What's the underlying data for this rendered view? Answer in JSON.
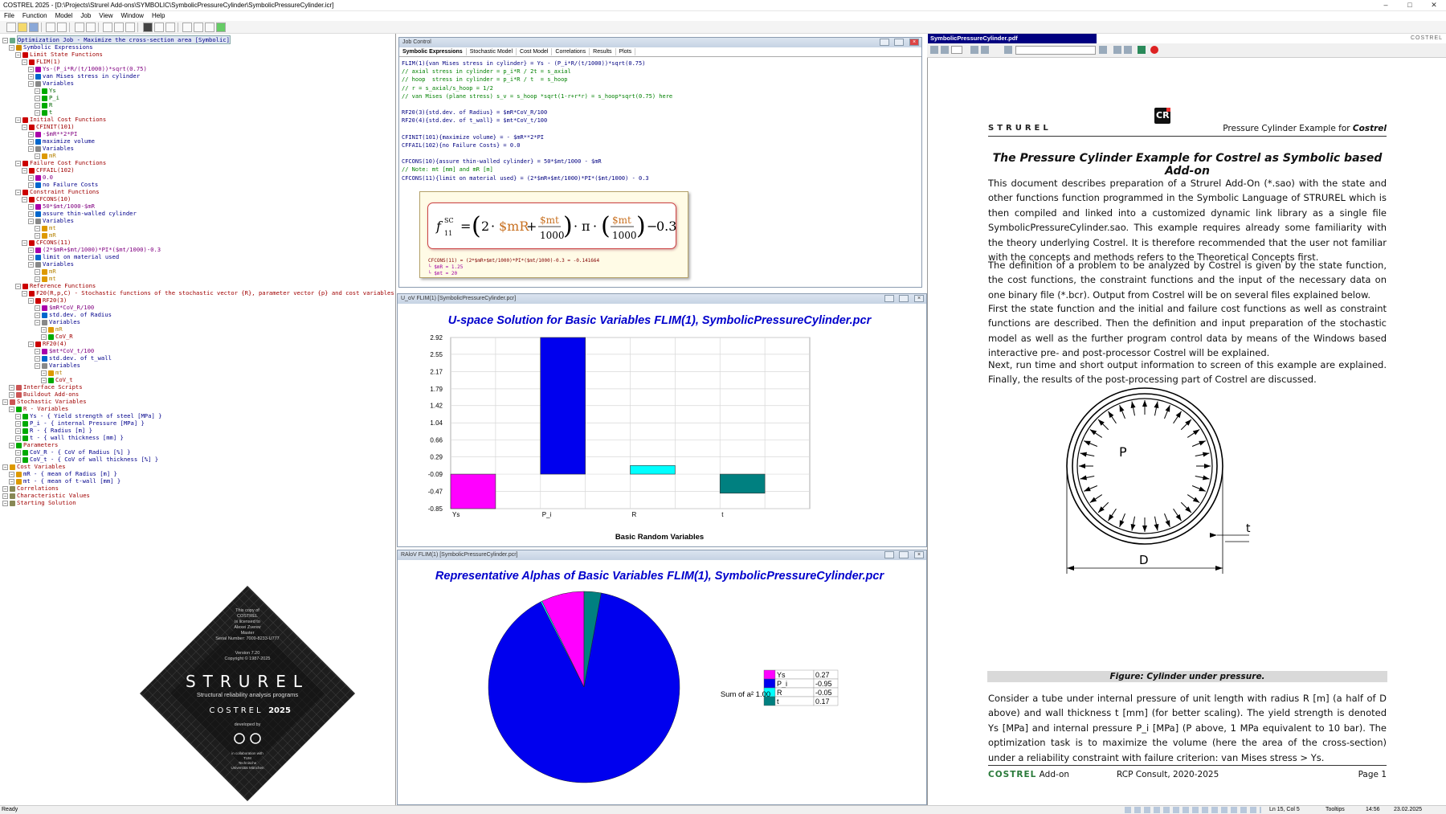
{
  "window": {
    "title": "COSTREL 2025 - [D:\\Projects\\Strurel Add-ons\\SYMBOLIC\\SymbolicPressureCylinder\\SymbolicPressureCylinder.icr]",
    "min": "–",
    "max": "□",
    "close": "✕"
  },
  "menu": [
    "File",
    "Function",
    "Model",
    "Job",
    "View",
    "Window",
    "Help"
  ],
  "tree": [
    {
      "d": 0,
      "t": "Optimization Job - Maximize the cross-section area [Symbolic]",
      "c": "c-blue",
      "hl": true,
      "ic": "#6a8"
    },
    {
      "d": 1,
      "t": "Symbolic Expressions",
      "c": "c-blue",
      "ic": "#c80"
    },
    {
      "d": 2,
      "t": "Limit State Functions",
      "c": "c-red",
      "ic": "#c00"
    },
    {
      "d": 3,
      "t": "FLIM(1)",
      "c": "c-red",
      "ic": "#c00"
    },
    {
      "d": 4,
      "t": "Ys-(P_i*R/(t/1000))*sqrt(0.75)",
      "c": "c-mag",
      "ic": "#a0a"
    },
    {
      "d": 4,
      "t": "van Mises stress in cylinder",
      "c": "c-blue",
      "ic": "#06c"
    },
    {
      "d": 4,
      "t": "Variables",
      "c": "c-blue",
      "ic": "#888"
    },
    {
      "d": 5,
      "t": "Ys",
      "c": "c-grn",
      "ic": "#0a0"
    },
    {
      "d": 5,
      "t": "P_i",
      "c": "c-grn",
      "ic": "#0a0"
    },
    {
      "d": 5,
      "t": "R",
      "c": "c-grn",
      "ic": "#0a0"
    },
    {
      "d": 5,
      "t": "t",
      "c": "c-grn",
      "ic": "#0a0"
    },
    {
      "d": 2,
      "t": "Initial Cost Functions",
      "c": "c-red",
      "ic": "#c00"
    },
    {
      "d": 3,
      "t": "CFINIT(101)",
      "c": "c-red",
      "ic": "#c00"
    },
    {
      "d": 4,
      "t": "-$mR**2*PI",
      "c": "c-mag",
      "ic": "#a0a"
    },
    {
      "d": 4,
      "t": "maximize volume",
      "c": "c-blue",
      "ic": "#06c"
    },
    {
      "d": 4,
      "t": "Variables",
      "c": "c-blue",
      "ic": "#888"
    },
    {
      "d": 5,
      "t": "mR",
      "c": "c-org",
      "ic": "#d90"
    },
    {
      "d": 2,
      "t": "Failure Cost Functions",
      "c": "c-red",
      "ic": "#c00"
    },
    {
      "d": 3,
      "t": "CFFAIL(102)",
      "c": "c-red",
      "ic": "#c00"
    },
    {
      "d": 4,
      "t": "0.0",
      "c": "c-mag",
      "ic": "#a0a"
    },
    {
      "d": 4,
      "t": "no Failure Costs",
      "c": "c-blue",
      "ic": "#06c"
    },
    {
      "d": 2,
      "t": "Constraint Functions",
      "c": "c-red",
      "ic": "#c00"
    },
    {
      "d": 3,
      "t": "CFCONS(10)",
      "c": "c-red",
      "ic": "#c00"
    },
    {
      "d": 4,
      "t": "50*$mt/1000-$mR",
      "c": "c-mag",
      "ic": "#a0a"
    },
    {
      "d": 4,
      "t": "assure thin-walled cylinder",
      "c": "c-blue",
      "ic": "#06c"
    },
    {
      "d": 4,
      "t": "Variables",
      "c": "c-blue",
      "ic": "#888"
    },
    {
      "d": 5,
      "t": "mt",
      "c": "c-org",
      "ic": "#d90"
    },
    {
      "d": 5,
      "t": "mR",
      "c": "c-org",
      "ic": "#d90"
    },
    {
      "d": 3,
      "t": "CFCONS(11)",
      "c": "c-red",
      "ic": "#c00"
    },
    {
      "d": 4,
      "t": "(2*$mR+$mt/1000)*PI*($mt/1000)-0.3",
      "c": "c-mag",
      "ic": "#a0a"
    },
    {
      "d": 4,
      "t": "limit on material used",
      "c": "c-blue",
      "ic": "#06c"
    },
    {
      "d": 4,
      "t": "Variables",
      "c": "c-blue",
      "ic": "#888"
    },
    {
      "d": 5,
      "t": "mR",
      "c": "c-org",
      "ic": "#d90"
    },
    {
      "d": 5,
      "t": "mt",
      "c": "c-org",
      "ic": "#d90"
    },
    {
      "d": 2,
      "t": "Reference Functions",
      "c": "c-red",
      "ic": "#c00"
    },
    {
      "d": 3,
      "t": "F20(R,p,C) - Stochastic functions of the stochastic vector {R}, parameter vector {p} and cost variables {$}",
      "c": "c-red",
      "ic": "#c00"
    },
    {
      "d": 4,
      "t": "RF20(3)",
      "c": "c-red",
      "ic": "#c00"
    },
    {
      "d": 5,
      "t": "$mR*CoV_R/100",
      "c": "c-mag",
      "ic": "#a0a"
    },
    {
      "d": 5,
      "t": "std.dev. of Radius",
      "c": "c-blue",
      "ic": "#06c"
    },
    {
      "d": 5,
      "t": "Variables",
      "c": "c-blue",
      "ic": "#888"
    },
    {
      "d": 6,
      "t": "mR",
      "c": "c-org",
      "ic": "#d90"
    },
    {
      "d": 6,
      "t": "CoV_R",
      "c": "c-red",
      "ic": "#0a0"
    },
    {
      "d": 4,
      "t": "RF20(4)",
      "c": "c-red",
      "ic": "#c00"
    },
    {
      "d": 5,
      "t": "$mt*CoV_t/100",
      "c": "c-mag",
      "ic": "#a0a"
    },
    {
      "d": 5,
      "t": "std.dev. of t_wall",
      "c": "c-blue",
      "ic": "#06c"
    },
    {
      "d": 5,
      "t": "Variables",
      "c": "c-blue",
      "ic": "#888"
    },
    {
      "d": 6,
      "t": "mt",
      "c": "c-org",
      "ic": "#d90"
    },
    {
      "d": 6,
      "t": "CoV_t",
      "c": "c-red",
      "ic": "#0a0"
    },
    {
      "d": 1,
      "t": "Interface Scripts",
      "c": "c-red",
      "ic": "#c55"
    },
    {
      "d": 1,
      "t": "Buildout Add-ons",
      "c": "c-red",
      "ic": "#c55"
    },
    {
      "d": 0,
      "t": "Stochastic Variables",
      "c": "c-red",
      "ic": "#c55"
    },
    {
      "d": 1,
      "t": "R - Variables",
      "c": "c-red",
      "ic": "#0a0"
    },
    {
      "d": 2,
      "t": "Ys - { Yield strength of steel [MPa] }",
      "c": "c-blue",
      "ic": "#0a0"
    },
    {
      "d": 2,
      "t": "P_i - { internal Pressure [MPa] }",
      "c": "c-blue",
      "ic": "#0a0"
    },
    {
      "d": 2,
      "t": "R - { Radius [m] }",
      "c": "c-blue",
      "ic": "#0a0"
    },
    {
      "d": 2,
      "t": "t - { wall thickness [mm] }",
      "c": "c-blue",
      "ic": "#0a0"
    },
    {
      "d": 1,
      "t": "Parameters",
      "c": "c-red",
      "ic": "#0a0"
    },
    {
      "d": 2,
      "t": "CoV_R - { CoV of Radius [%] }",
      "c": "c-blue",
      "ic": "#0a0"
    },
    {
      "d": 2,
      "t": "CoV_t - { CoV of wall thickness [%] }",
      "c": "c-blue",
      "ic": "#0a0"
    },
    {
      "d": 0,
      "t": "Cost Variables",
      "c": "c-red",
      "ic": "#d90"
    },
    {
      "d": 1,
      "t": "mR - { mean of Radius [m] }",
      "c": "c-blue",
      "ic": "#d90"
    },
    {
      "d": 1,
      "t": "mt - { mean of t-wall [mm] }",
      "c": "c-blue",
      "ic": "#d90"
    },
    {
      "d": 0,
      "t": "Correlations",
      "c": "c-red",
      "ic": "#885"
    },
    {
      "d": 0,
      "t": "Characteristic Values",
      "c": "c-red",
      "ic": "#885"
    },
    {
      "d": 0,
      "t": "Starting Solution",
      "c": "c-red",
      "ic": "#885"
    }
  ],
  "badge": {
    "copy": [
      "This copy of",
      "COSTREL",
      "is licensed to",
      "Alexei Zverev",
      "Master",
      "Serial Number: 7009-8233-U777"
    ],
    "version": "Version 7.20",
    "copyright": "Copyright © 1987-2025",
    "brand": "STRUREL",
    "sub": "Structural reliability analysis programs",
    "costrel": "COSTREL",
    "year": "2025",
    "developed": "developed by",
    "collab": [
      "in collaboration with",
      "TUM",
      "Technische",
      "Universität München"
    ]
  },
  "job": {
    "title": "Job Control",
    "tabs": [
      "Symbolic Expressions",
      "Stochastic Model",
      "Cost Model",
      "Correlations",
      "Results",
      "Plots"
    ],
    "code": [
      "FLIM(1){van Mises stress in cylinder} = Ys - (P_i*R/(t/1000))*sqrt(0.75)",
      "// axial stress in cylinder = p_i*R / 2t = s_axial",
      "// hoop  stress in cylinder = p_i*R / t  = s_hoop",
      "// r = s_axial/s_hoop = 1/2",
      "// van Mises (plane stress) s_v = s_hoop *sqrt(1-r+r*r) = s_hoop*sqrt(0.75) here",
      "",
      "RF20(3){std.dev. of Radius} = $mR*CoV_R/100",
      "RF20(4){std.dev. of t_wall} = $mt*CoV_t/100",
      "",
      "CFINIT(101){maximize volume} = - $mR**2*PI",
      "CFFAIL(102){no Failure Costs} = 0.0",
      "",
      "CFCONS(10){assure thin-walled cylinder} = 50*$mt/1000 - $mR",
      "// Note: mt [mm] and mR [m]",
      "CFCONS(11){limit on material used} = (2*$mR+$mt/1000)*PI*($mt/1000) - 0.3"
    ],
    "tip": {
      "formula_lhs": "f",
      "formula_sup": "SC",
      "formula_sub": "11",
      "result": "CFCONS(11) = (2*$mR+$mt/1000)*PI*($mt/1000)-0.3 = -0.141664",
      "v1": "└ $mR = 1.25",
      "v2": "└ $mt = 20"
    }
  },
  "chart_win_title": "U_oV FLIM(1) [SymbolicPressureCylinder.pcr]",
  "pie_win_title": "RAloV FLIM(1) [SymbolicPressureCylinder.pcr]",
  "chart_data": [
    {
      "type": "bar",
      "title": "U-space Solution for Basic Variables FLIM(1), SymbolicPressureCylinder.pcr",
      "xlabel": "Basic Random Variables",
      "ylabel": "",
      "categories": [
        "Ys",
        "P_i",
        "R",
        "t"
      ],
      "values": [
        -0.85,
        2.92,
        0.1,
        -0.51
      ],
      "colors": [
        "#ff00ff",
        "#0000ee",
        "#00ffff",
        "#008080"
      ],
      "yticks": [
        2.92,
        2.55,
        2.17,
        1.79,
        1.42,
        1.04,
        0.66,
        0.29,
        -0.09,
        -0.47,
        -0.85
      ],
      "ylim": [
        -0.85,
        2.92
      ],
      "grid": true
    },
    {
      "type": "pie",
      "title": "Representative Alphas of Basic Variables FLIM(1), SymbolicPressureCylinder.pcr",
      "labels": [
        "Ys",
        "P_i",
        "R",
        "t"
      ],
      "alphas": [
        0.27,
        -0.95,
        -0.05,
        0.17
      ],
      "colors": [
        "#ff00ff",
        "#0000ee",
        "#00ffff",
        "#008080"
      ],
      "sum_label": "Sum of a² 1.00",
      "legend": "right"
    }
  ],
  "pdf": {
    "title": "SymbolicPressureCylinder.pdf",
    "right_tag": "COSTREL",
    "brand": "STRUREL",
    "header_right": "Pressure Cylinder Example for ",
    "header_right_em": "Costrel",
    "heading": "The Pressure Cylinder Example for Costrel as Symbolic based Add-on",
    "paras": [
      "This document describes preparation of a Strurel Add-On (*.sao) with the state and other functions function programmed in the Symbolic Language of STRUREL which is then compiled and linked into a customized dynamic link library as a single file SymbolicPressureCylinder.sao. This example requires already some familiarity with the theory underlying Costrel. It is therefore recommended that the user not familiar with the concepts and methods refers to the Theoretical Concepts first.",
      "The definition of a problem to be analyzed by Costrel is given by the state function, the cost functions, the constraint functions and the input of the necessary data on one binary file (*.bcr). Output from Costrel will be on several files explained below.",
      "First the state function and the initial and failure cost functions as well as constraint functions are described. Then the definition and input preparation of the stochastic model as well as the further program control data by means of the Windows based interactive pre- and post-processor Costrel will be explained.",
      "Next, run time and short output information to screen of this example are explained. Finally, the results of the post-processing part of Costrel are discussed."
    ],
    "fig_P": "P",
    "fig_t": "t",
    "fig_D": "D",
    "caption": "Figure: Cylinder under pressure.",
    "last_para": "Consider a tube under internal pressure of unit length with radius R [m] (a half of D above) and wall thickness t [mm] (for better scaling). The yield strength is denoted Ys [MPa] and internal pressure P_i [MPa] (P above, 1 MPa equivalent to 10 bar). The optimization task is to maximize the volume (here the area of the cross-section) under a reliability constraint with failure criterion: van Mises stress > Ys.",
    "footer_left": "COSTREL",
    "footer_left2": "Add-on",
    "footer_mid": "RCP Consult, 2020-2025",
    "footer_right": "Page 1"
  },
  "status": {
    "left": "Ready",
    "pos": "Ln 15, Col 5",
    "tooltips": "Tooltips",
    "time": "14:56",
    "date": "23.02.2025"
  }
}
